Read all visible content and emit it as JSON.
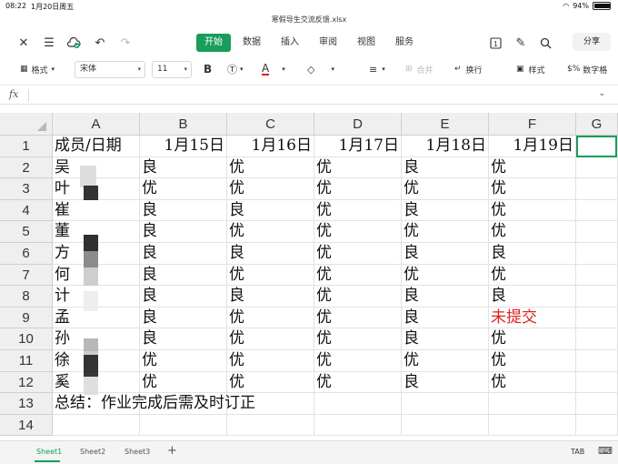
{
  "status": {
    "time": "08:22",
    "date": "1月20日周五",
    "battery": "94%",
    "battery_level": 0.94
  },
  "file": {
    "name": "寒假导生交流反馈.xlsx"
  },
  "toolbar": {
    "tabs": [
      "开始",
      "数据",
      "插入",
      "审阅",
      "视图",
      "服务"
    ],
    "share_label": "分享",
    "format_label": "格式",
    "font_name": "宋体",
    "font_size": "11",
    "bold_label": "B",
    "merge_label": "合并",
    "wrap_label": "换行",
    "style_label": "样式",
    "number_label": "数字格"
  },
  "formula": {
    "fx_label": "fx",
    "value": ""
  },
  "sheet": {
    "columns": [
      "A",
      "B",
      "C",
      "D",
      "E",
      "F",
      "G"
    ],
    "rows": [
      "1",
      "2",
      "3",
      "4",
      "5",
      "6",
      "7",
      "8",
      "9",
      "10",
      "11",
      "12",
      "13",
      "14"
    ],
    "header_row": [
      "成员/日期",
      "1月15日",
      "1月16日",
      "1月17日",
      "1月18日",
      "1月19日"
    ],
    "names": [
      "吴",
      "叶",
      "崔",
      "董",
      "方",
      "何",
      "计",
      "孟",
      "孙",
      "徐",
      "奚"
    ],
    "grades": [
      [
        "良",
        "优",
        "优",
        "良",
        "优"
      ],
      [
        "优",
        "优",
        "优",
        "优",
        "优"
      ],
      [
        "良",
        "良",
        "优",
        "良",
        "优"
      ],
      [
        "良",
        "优",
        "优",
        "优",
        "优"
      ],
      [
        "良",
        "良",
        "优",
        "良",
        "良"
      ],
      [
        "良",
        "优",
        "优",
        "优",
        "优"
      ],
      [
        "良",
        "良",
        "优",
        "良",
        "良"
      ],
      [
        "良",
        "优",
        "优",
        "良",
        "未提交"
      ],
      [
        "良",
        "优",
        "优",
        "良",
        "优"
      ],
      [
        "优",
        "优",
        "优",
        "优",
        "优"
      ],
      [
        "优",
        "优",
        "优",
        "良",
        "优"
      ]
    ],
    "summary": "总结：作业完成后需及时订正",
    "highlight_color": "#e02020",
    "accent_color": "#1a9c5b"
  },
  "sheet_tabs": {
    "tabs": [
      "Sheet1",
      "Sheet2",
      "Sheet3"
    ],
    "add_label": "+",
    "tab_key_label": "TAB"
  }
}
